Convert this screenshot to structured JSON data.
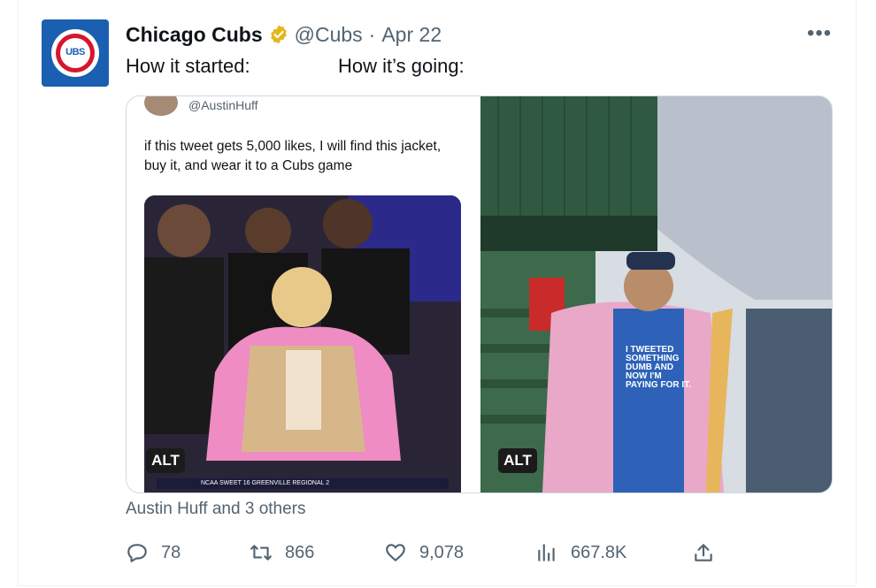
{
  "tweet": {
    "display_name": "Chicago Cubs",
    "handle": "@Cubs",
    "separator": "·",
    "date": "Apr 22",
    "text_left": "How it started:",
    "text_right": "How it’s going:",
    "avatar_text": "UBS",
    "more_icon": "more-horizontal-icon"
  },
  "media": {
    "left": {
      "quoted_handle": "@AustinHuff",
      "quoted_text": "if this tweet gets 5,000 likes, I will find this jacket, buy it, and wear it to a Cubs game",
      "banner_text": "NCAA SWEET 16  GREENVILLE REGIONAL 2",
      "alt_label": "ALT"
    },
    "right": {
      "shirt_text": "I TWEETED SOMETHING DUMB AND NOW I'M PAYING FOR IT.",
      "alt_label": "ALT"
    }
  },
  "liked_by": "Austin Huff and 3 others",
  "actions": {
    "replies": "78",
    "retweets": "866",
    "likes": "9,078",
    "views": "667.8K"
  },
  "colors": {
    "verified_gold": "#e2b719",
    "secondary_text": "#536471",
    "cubs_blue": "#1a5fb0",
    "cubs_red": "#d6162d"
  }
}
